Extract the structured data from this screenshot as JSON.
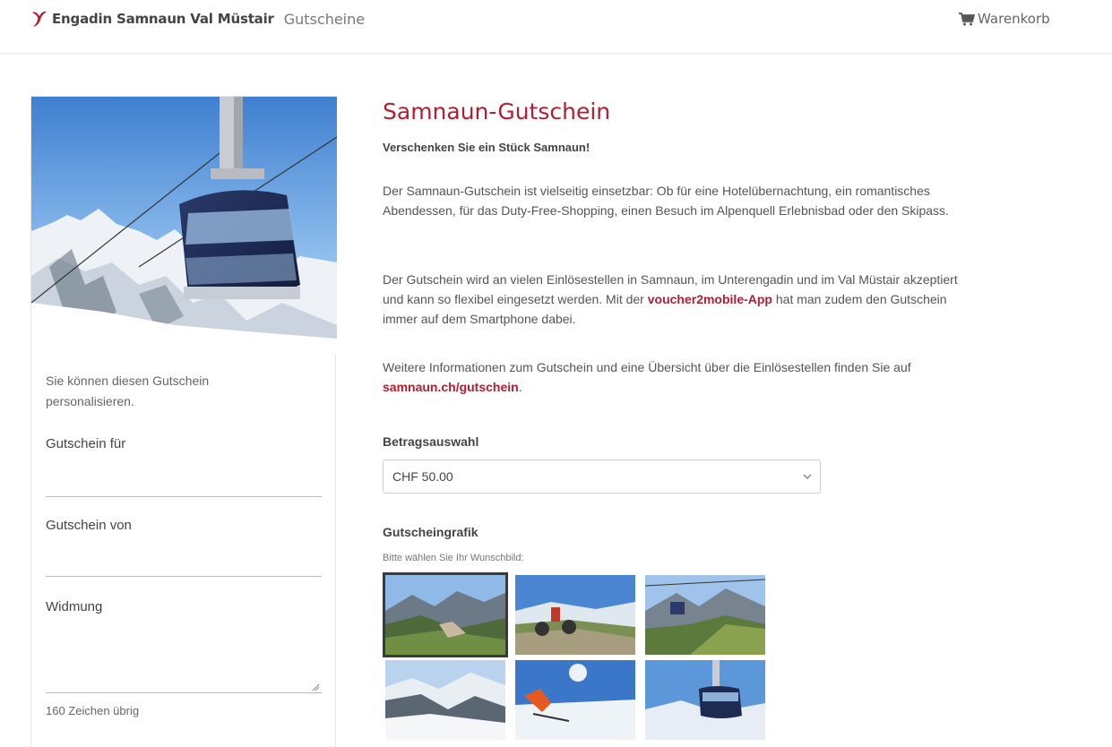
{
  "header": {
    "brand_name": "Engadin Samnaun Val Müstair",
    "brand_section": "Gutscheine",
    "cart_label": "Warenkorb",
    "cart_icon": "shopping-cart-icon",
    "accent_color": "#b41e32"
  },
  "sidebar": {
    "personalize_note": "Sie können diesen Gutschein personalisieren.",
    "field_for_label": "Gutschein für",
    "field_from_label": "Gutschein von",
    "field_dedication_label": "Widmung",
    "chars_left": "160 Zeichen übrig"
  },
  "main": {
    "title": "Samnaun-Gutschein",
    "lead": "Verschenken Sie ein Stück Samnaun!",
    "para1": "Der Samnaun-Gutschein ist vielseitig einsetzbar: Ob für eine Hotelübernachtung, ein romantisches Abendessen, für das Duty-Free-Shopping, einen Besuch im Alpenquell Erlebnisbad oder den Skipass.",
    "para2_before": "Der Gutschein wird an vielen Einlösestellen in Samnaun, im Unterengadin und im Val Müstair akzeptiert und kann so flexibel eingesetzt werden. Mit der ",
    "para2_link": "voucher2mobile-App",
    "para2_after": " hat man zudem den Gutschein immer auf dem Smartphone dabei.",
    "para3_before": "Weitere Informationen zum Gutschein und eine Übersicht über die Einlösestellen finden Sie auf ",
    "para3_link": "samnaun.ch/gutschein",
    "para3_after": ".",
    "amount_label": "Betragsauswahl",
    "amount_value": "CHF 50.00",
    "graphic_label": "Gutscheingrafik",
    "graphic_hint": "Bitte wählen Sie Ihr Wunschbild:",
    "selected_graphic_index": 0
  }
}
